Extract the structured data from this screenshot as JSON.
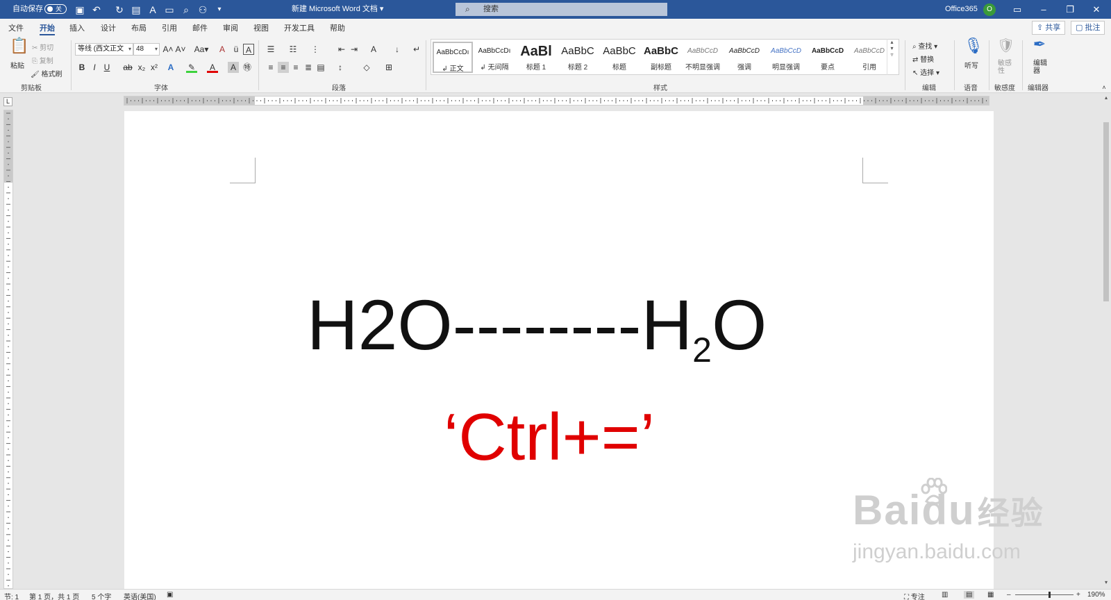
{
  "titlebar": {
    "autosave_label": "自动保存",
    "autosave_state": "关",
    "doc_title": "新建 Microsoft Word 文档 ▾",
    "search_placeholder": "搜索",
    "account": "Office365",
    "avatar_initial": "O"
  },
  "tabs": [
    "文件",
    "开始",
    "插入",
    "设计",
    "布局",
    "引用",
    "邮件",
    "审阅",
    "视图",
    "开发工具",
    "帮助"
  ],
  "active_tab": "开始",
  "share_label": "共享",
  "comment_label": "批注",
  "ribbon": {
    "clipboard": {
      "paste": "粘贴",
      "cut": "剪切",
      "copy": "复制",
      "format_painter": "格式刷",
      "label": "剪贴板"
    },
    "font": {
      "font_name": "等线 (西文正文",
      "font_size": "48",
      "label": "字体"
    },
    "paragraph": {
      "label": "段落"
    },
    "styles": {
      "label": "样式",
      "items": [
        {
          "sample": "AaBbCcDı",
          "name": "↲ 正文"
        },
        {
          "sample": "AaBbCcDı",
          "name": "↲ 无间隔"
        },
        {
          "sample": "AaBl",
          "name": "标题 1"
        },
        {
          "sample": "AaBbC",
          "name": "标题 2"
        },
        {
          "sample": "AaBbC",
          "name": "标题"
        },
        {
          "sample": "AaBbC",
          "name": "副标题"
        },
        {
          "sample": "AaBbCcD",
          "name": "不明显强调"
        },
        {
          "sample": "AaBbCcD",
          "name": "强调"
        },
        {
          "sample": "AaBbCcD",
          "name": "明显强调"
        },
        {
          "sample": "AaBbCcD",
          "name": "要点"
        },
        {
          "sample": "AaBbCcD",
          "name": "引用"
        }
      ]
    },
    "editing": {
      "find": "查找",
      "replace": "替换",
      "select": "选择",
      "label": "编辑"
    },
    "voice": {
      "dictate": "听写",
      "label": "语音"
    },
    "sensitivity": {
      "button": "敏感性",
      "label": "敏感度"
    },
    "editor": {
      "button": "编辑器",
      "label": "编辑器"
    }
  },
  "document": {
    "formula_plain": "H2O--------H",
    "formula_sub": "2",
    "formula_end": "O",
    "shortcut_text": "‘Ctrl+=’"
  },
  "watermark": {
    "main": "Baidu",
    "cn": "经验",
    "sub": "jingyan.baidu.com"
  },
  "statusbar": {
    "section": "节: 1",
    "page": "第 1 页，共 1 页",
    "words": "5 个字",
    "language": "英语(美国)",
    "focus": "专注",
    "zoom": "190%"
  },
  "colors": {
    "titlebar": "#2b579a",
    "shortcut_red": "#e00000"
  }
}
